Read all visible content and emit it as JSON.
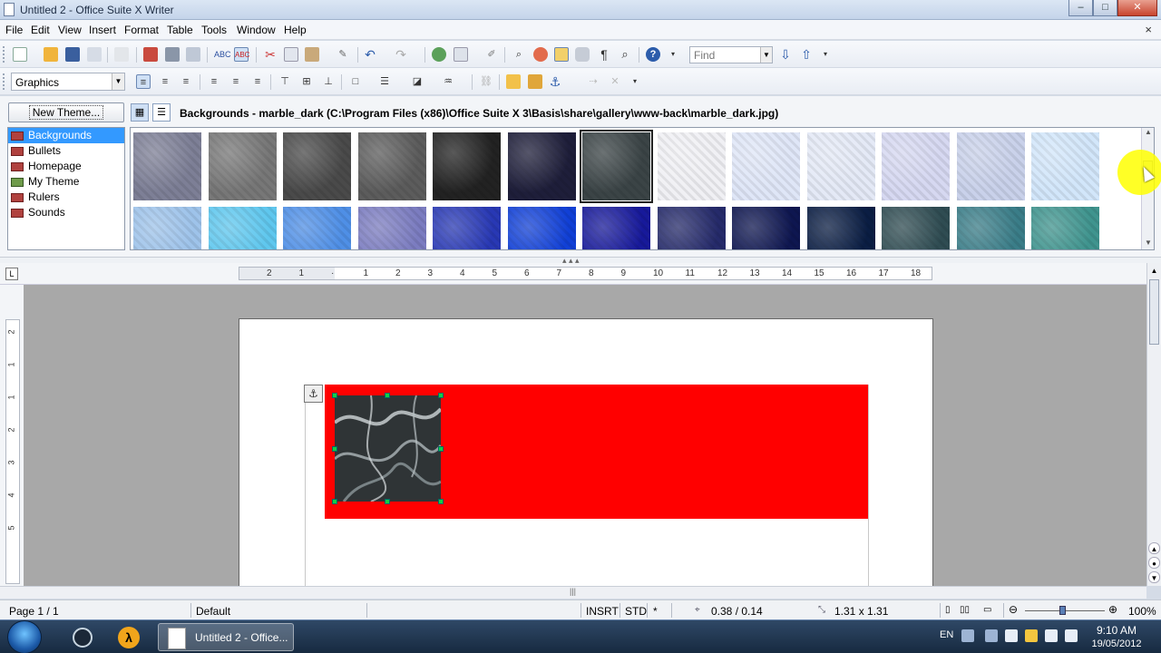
{
  "window": {
    "title": "Untitled 2 - Office Suite X Writer",
    "minimize": "–",
    "maximize": "□",
    "close": "✕"
  },
  "menubar": {
    "items": [
      "File",
      "Edit",
      "View",
      "Insert",
      "Format",
      "Table",
      "Tools",
      "Window",
      "Help"
    ],
    "doc_close": "×"
  },
  "toolbar1": {
    "find_placeholder": "Find"
  },
  "toolbar2": {
    "style_value": "Graphics"
  },
  "gallery": {
    "new_theme_label": "New Theme...",
    "path_label": "Backgrounds - marble_dark (C:\\Program Files (x86)\\Office Suite X 3\\Basis\\share\\gallery\\www-back\\marble_dark.jpg)",
    "themes": [
      "Backgrounds",
      "Bullets",
      "Homepage",
      "My Theme",
      "Rulers",
      "Sounds"
    ],
    "selected_theme": 0,
    "thumbs_row1": [
      "#7d7f96",
      "#777777",
      "#4a4a4a",
      "#5c5c5c",
      "#222222",
      "#1e1e3a",
      "#3b4446",
      "#f0f0f4",
      "#dfe6f7",
      "#e4e9f6",
      "#d6d8f1",
      "#c9d1ea",
      "#d2e6fa"
    ],
    "thumbs_row2": [
      "#9ec3ea",
      "#5fc7ee",
      "#4f8fe6",
      "#7b7cc0",
      "#2838b4",
      "#1140d6",
      "#17199a",
      "#252a6a",
      "#0e1650",
      "#0a1d43",
      "#2f4c52",
      "#3a7d88",
      "#3f948e"
    ],
    "selected_thumb": 6
  },
  "ruler": {
    "h_ticks": [
      "2",
      "1",
      "",
      "1",
      "2",
      "3",
      "4",
      "5",
      "6",
      "7",
      "8",
      "9",
      "10",
      "11",
      "12",
      "13",
      "14",
      "15",
      "16",
      "17",
      "18"
    ],
    "v_ticks": [
      "2",
      "1",
      "1",
      "2",
      "3",
      "4",
      "5"
    ]
  },
  "status": {
    "page": "Page 1 / 1",
    "style": "Default",
    "mode": "INSRT",
    "sel": "STD",
    "modified": "*",
    "position": "0.38 / 0.14",
    "size": "1.31 x 1.31",
    "zoom": "100%"
  },
  "taskbar": {
    "app_label": "Untitled 2 - Office...",
    "lang": "EN",
    "time": "9:10 AM",
    "date": "19/05/2012"
  },
  "colors": {
    "accent": "#3399ff",
    "frame": "#ff0000"
  }
}
